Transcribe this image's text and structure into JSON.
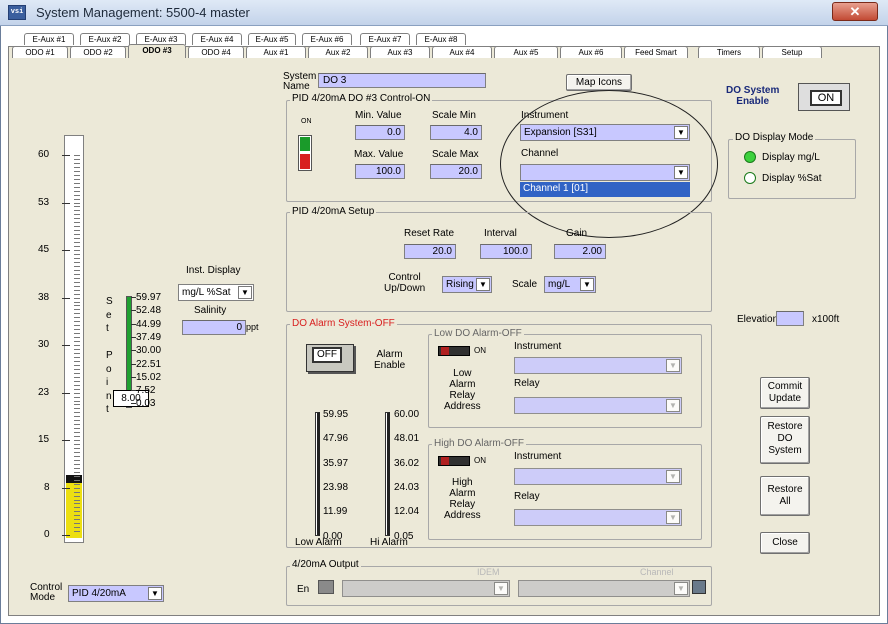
{
  "window": {
    "title": "System Management: 5500-4 master",
    "app_icon_text": "vsi",
    "close_glyph": "✕"
  },
  "tabs_row1": [
    "E-Aux #1",
    "E-Aux #2",
    "E-Aux #3",
    "E-Aux #4",
    "E-Aux #5",
    "E-Aux #6",
    "E-Aux #7",
    "E-Aux #8"
  ],
  "tabs_row2": [
    "ODO #1",
    "ODO #2",
    "ODO #3",
    "ODO #4",
    "Aux #1",
    "Aux #2",
    "Aux #3",
    "Aux #4",
    "Aux #5",
    "Aux #6",
    "Feed Smart",
    "Timers",
    "Setup"
  ],
  "active_tab": "ODO #3",
  "system_name": {
    "label": "System\nName",
    "value": "DO 3"
  },
  "map_icons": "Map Icons",
  "do_enable": {
    "label": "DO System\nEnable",
    "button": "ON"
  },
  "do_display_mode": {
    "title": "DO Display Mode",
    "options": [
      "Display mg/L",
      "Display %Sat"
    ],
    "selected": 0
  },
  "pid_control": {
    "title": "PID 4/20mA DO #3 Control-ON",
    "indicator": "ON",
    "min_value_label": "Min. Value",
    "min_value": "0.0",
    "scale_min_label": "Scale Min",
    "scale_min": "4.0",
    "max_value_label": "Max. Value",
    "max_value": "100.0",
    "scale_max_label": "Scale Max",
    "scale_max": "20.0",
    "instrument_label": "Instrument",
    "instrument": "Expansion [S31]",
    "channel_label": "Channel",
    "channel": "",
    "channel_option": "Channel 1 [01]"
  },
  "pid_setup": {
    "title": "PID 4/20mA Setup",
    "reset_rate_label": "Reset Rate",
    "reset_rate": "20.0",
    "interval_label": "Interval",
    "interval": "100.0",
    "gain_label": "Gain",
    "gain": "2.00",
    "control_label": "Control\nUp/Down",
    "control": "Rising",
    "scale_label": "Scale",
    "scale": "mg/L"
  },
  "main_scale": {
    "ticks": [
      "60",
      "53",
      "45",
      "38",
      "30",
      "23",
      "15",
      "8",
      "0"
    ],
    "value_fraction": 0.08
  },
  "setpoint": {
    "letters": [
      "S",
      "e",
      "t",
      "",
      "P",
      "o",
      "i",
      "n",
      "t"
    ],
    "ticks": [
      "59.97",
      "52.48",
      "44.99",
      "37.49",
      "30.00",
      "22.51",
      "15.02",
      "7.52",
      "0.03"
    ],
    "value": "8.00",
    "level_fraction": 0.13
  },
  "inst_display": {
    "label": "Inst. Display",
    "value": "mg/L %Sat"
  },
  "salinity": {
    "label": "Salinity",
    "value": "0",
    "unit": "ppt"
  },
  "alarm": {
    "title": "DO Alarm System-OFF",
    "button": "OFF",
    "enable_label": "Alarm\nEnable",
    "low_ticks": [
      "59.95",
      "47.96",
      "35.97",
      "23.98",
      "11.99",
      "0.00"
    ],
    "hi_ticks": [
      "60.00",
      "48.01",
      "36.02",
      "24.03",
      "12.04",
      "0.05"
    ],
    "low_label": "Low Alarm",
    "hi_label": "Hi Alarm",
    "low_group": {
      "title": "Low DO Alarm-OFF",
      "on": "ON",
      "instrument_label": "Instrument",
      "relay_label": "Relay",
      "address_label": "Low\nAlarm\nRelay\nAddress"
    },
    "high_group": {
      "title": "High DO Alarm-OFF",
      "on": "ON",
      "instrument_label": "Instrument",
      "relay_label": "Relay",
      "address_label": "High\nAlarm\nRelay\nAddress"
    }
  },
  "elevation": {
    "label": "Elevation",
    "value": "",
    "unit": "x100ft"
  },
  "buttons": {
    "commit": "Commit\nUpdate",
    "restore_do": "Restore\nDO\nSystem",
    "restore_all": "Restore\nAll",
    "close": "Close"
  },
  "output": {
    "title": "4/20mA Output",
    "en": "En",
    "idem": "IDEM",
    "channel": "Channel"
  },
  "control_mode": {
    "label": "Control\nMode",
    "value": "PID 4/20mA"
  },
  "colors": {
    "panel": "#ece9d8",
    "field": "#c8c8ff",
    "red": "#d81f1f",
    "green": "#1a9b2a",
    "yellow": "#f0e020"
  }
}
